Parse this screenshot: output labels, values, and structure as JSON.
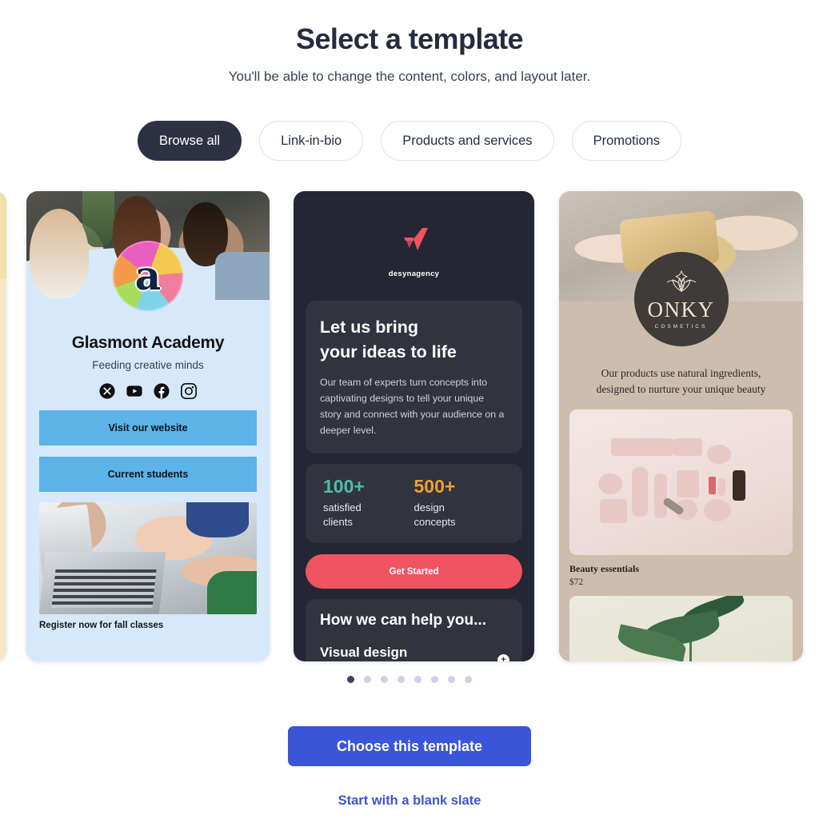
{
  "header": {
    "title": "Select a template",
    "subtitle": "You'll be able to change the content, colors, and layout later."
  },
  "filters": [
    {
      "label": "Browse all",
      "active": true
    },
    {
      "label": "Link-in-bio",
      "active": false
    },
    {
      "label": "Products and services",
      "active": false
    },
    {
      "label": "Promotions",
      "active": false
    }
  ],
  "cards": {
    "glasmont": {
      "name": "Glasmont Academy",
      "tagline": "Feeding creative minds",
      "logo_letter": "a",
      "social_icons": [
        "x-icon",
        "youtube-icon",
        "facebook-icon",
        "instagram-icon"
      ],
      "buttons": [
        "Visit our website",
        "Current students"
      ],
      "caption": "Register now for fall classes",
      "bg_color": "#d6e8fa",
      "button_color": "#5bb3e8"
    },
    "desynagency": {
      "brand": "desynagency",
      "heading_line1": "Let us bring",
      "heading_line2": "your ideas to life",
      "body": "Our team of experts turn concepts into captivating designs to tell your unique story and connect with your audience on a deeper level.",
      "stats": [
        {
          "number": "100+",
          "label_line1": "satisfied",
          "label_line2": "clients",
          "color": "#4bbfa5"
        },
        {
          "number": "500+",
          "label_line1": "design",
          "label_line2": "concepts",
          "color": "#efa033"
        }
      ],
      "cta": "Get Started",
      "section_title": "How we can help you...",
      "section_item": "Visual design",
      "expand_icon": "plus-icon",
      "bg_color": "#242733",
      "accent_color": "#ef5460"
    },
    "onky": {
      "brand": "ONKY",
      "brand_sub": "COSMETICS",
      "tagline_line1": "Our products use natural ingredients,",
      "tagline_line2": "designed to nurture your unique beauty",
      "product_title": "Beauty essentials",
      "product_price": "$72",
      "bg_color": "#cdbdac"
    }
  },
  "carousel": {
    "dots": 8,
    "active_index": 0
  },
  "footer": {
    "choose_label": "Choose this template",
    "blank_label": "Start with a blank slate",
    "accent_color": "#3b55d9"
  }
}
